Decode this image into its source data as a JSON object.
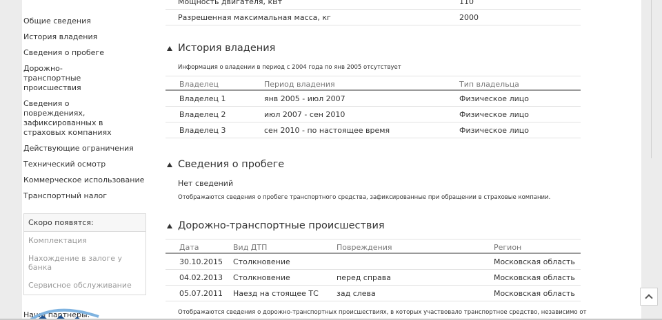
{
  "sidebar": {
    "links": [
      "Общие сведения",
      "История владения",
      "Сведения о пробеге",
      "Дорожно-транспортные происшествия",
      "Сведения о повреждениях, зафиксированных в страховых компаниях",
      "Действующие ограничения",
      "Технический осмотр",
      "Коммерческое использование",
      "Транспортный налог"
    ],
    "coming_title": "Скоро появятся:",
    "coming_items": [
      "Комплектация",
      "Нахождение в залоге у банка",
      "Сервисное обслуживание"
    ],
    "partners_title": "Наши партнеры:"
  },
  "general_rows": [
    {
      "key": "Мощность двигателя, кВт",
      "value": "110"
    },
    {
      "key": "Разрешенная максимальная масса, кг",
      "value": "2000"
    }
  ],
  "ownership": {
    "title": "История владения",
    "note": "Информация о владении в период с 2004 года по янв 2005 отсутствует",
    "columns": [
      "Владелец",
      "Период владения",
      "Тип владельца"
    ],
    "rows": [
      [
        "Владелец 1",
        "янв 2005 - июл 2007",
        "Физическое лицо"
      ],
      [
        "Владелец 2",
        "июл 2007 - сен 2010",
        "Физическое лицо"
      ],
      [
        "Владелец 3",
        "сен 2010 - по настоящее время",
        "Физическое лицо"
      ]
    ]
  },
  "mileage": {
    "title": "Сведения о пробеге",
    "status": "Нет сведений",
    "note": "Отображаются сведения о пробеге транспортного средства, зафиксированные при обращении в страховые компании."
  },
  "accidents": {
    "title": "Дорожно-транспортные происшествия",
    "columns": [
      "Дата",
      "Вид ДТП",
      "Повреждения",
      "Регион"
    ],
    "rows": [
      [
        "30.10.2015",
        "Столкновение",
        "",
        "Московская область"
      ],
      [
        "04.02.2013",
        "Столкновение",
        "перед справа",
        "Московская область"
      ],
      [
        "05.07.2011",
        "Наезд на стоящее ТС",
        "зад слева",
        "Московская область"
      ]
    ],
    "note": "Отображаются сведения о дорожно-транспортных происшествиях, в которых участвовало транспортное средство, независимо от"
  },
  "icons": {
    "scroll_top": "chevron-up-icon",
    "section_toggle": "triangle-up-icon"
  },
  "colors": {
    "partner_logo": "#1a4f8f",
    "partner_arc": "#7fb3e0"
  }
}
